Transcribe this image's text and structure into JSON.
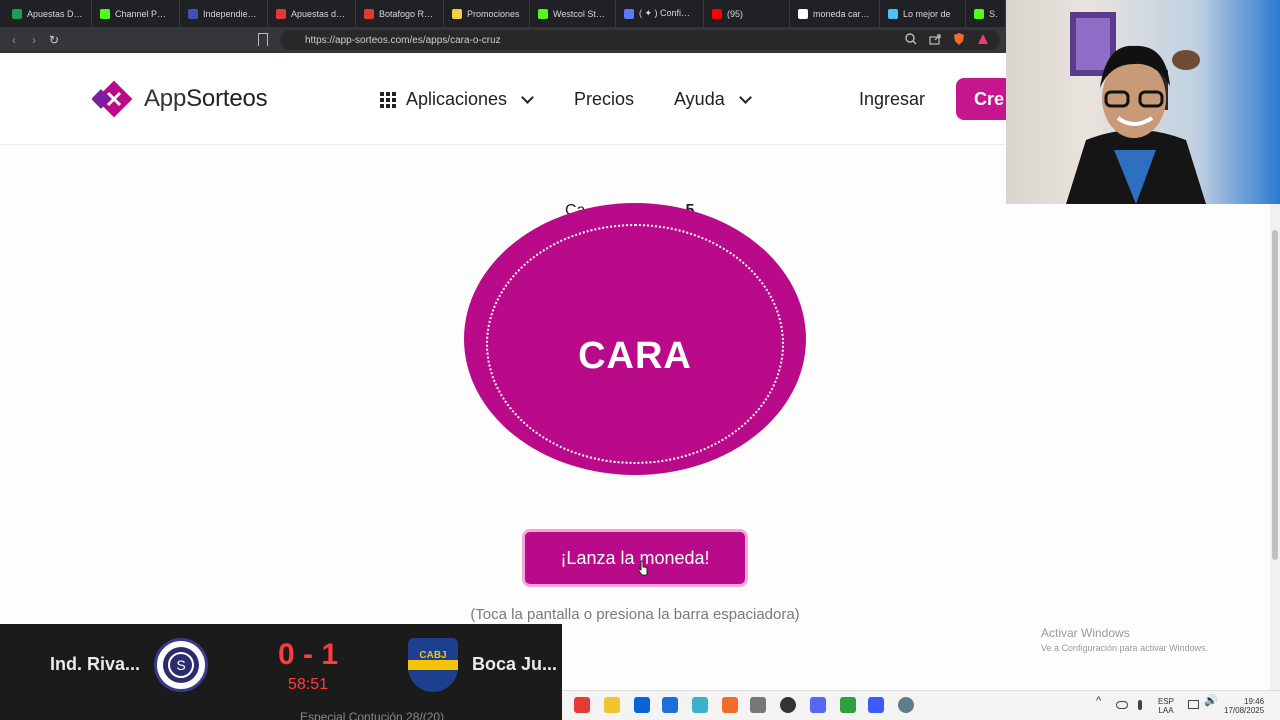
{
  "browser": {
    "tabs": [
      {
        "label": "Apuestas Depo",
        "color": "#1f9d55"
      },
      {
        "label": "Channel Points",
        "color": "#53fc18"
      },
      {
        "label": "Independiente",
        "color": "#3f51b5"
      },
      {
        "label": "Apuestas depo",
        "color": "#e53935"
      },
      {
        "label": "Botafogo RJ - F",
        "color": "#e53935"
      },
      {
        "label": "Promociones",
        "color": "#f4d03f"
      },
      {
        "label": "Westcol Stream",
        "color": "#53fc18"
      },
      {
        "label": "( ✦ ) Configura",
        "color": "#5b7cfa"
      },
      {
        "label": "(95)",
        "color": "#ff0000"
      },
      {
        "label": "moneda cara o",
        "color": "#ffffff"
      },
      {
        "label": "Lo mejor de",
        "color": "#4fc3f7"
      },
      {
        "label": "St",
        "color": "#53fc18"
      }
    ],
    "url": "https://app-sorteos.com/es/apps/cara-o-cruz"
  },
  "header": {
    "logo_plain": "App",
    "logo_bold": "Sorteos",
    "nav": {
      "aplicaciones": "Aplicaciones",
      "precios": "Precios",
      "ayuda": "Ayuda",
      "ingresar": "Ingresar",
      "crear": "Cre"
    }
  },
  "main": {
    "counter_label": "Ca",
    "counter_value": "5",
    "coin_label": "CARA",
    "flip_button": "¡Lanza la moneda!",
    "hint": "(Toca la pantalla o presiona la barra espaciadora)"
  },
  "windows_watermark": {
    "line1": "Activar Windows",
    "line2": "Ve a Configuración para activar Windows."
  },
  "scoreboard": {
    "home_team": "Ind. Riva...",
    "away_team": "Boca Ju...",
    "score": "0 - 1",
    "clock": "58:51",
    "subline": "Especial Contución 28/(20)"
  },
  "taskbar": {
    "lang_top": "ESP",
    "lang_bottom": "LAA",
    "time": "19:46",
    "date": "17/08/2025"
  },
  "colors": {
    "brand": "#b80a89",
    "brand_light": "#f2a7d8",
    "score_red": "#ff3b3b"
  }
}
